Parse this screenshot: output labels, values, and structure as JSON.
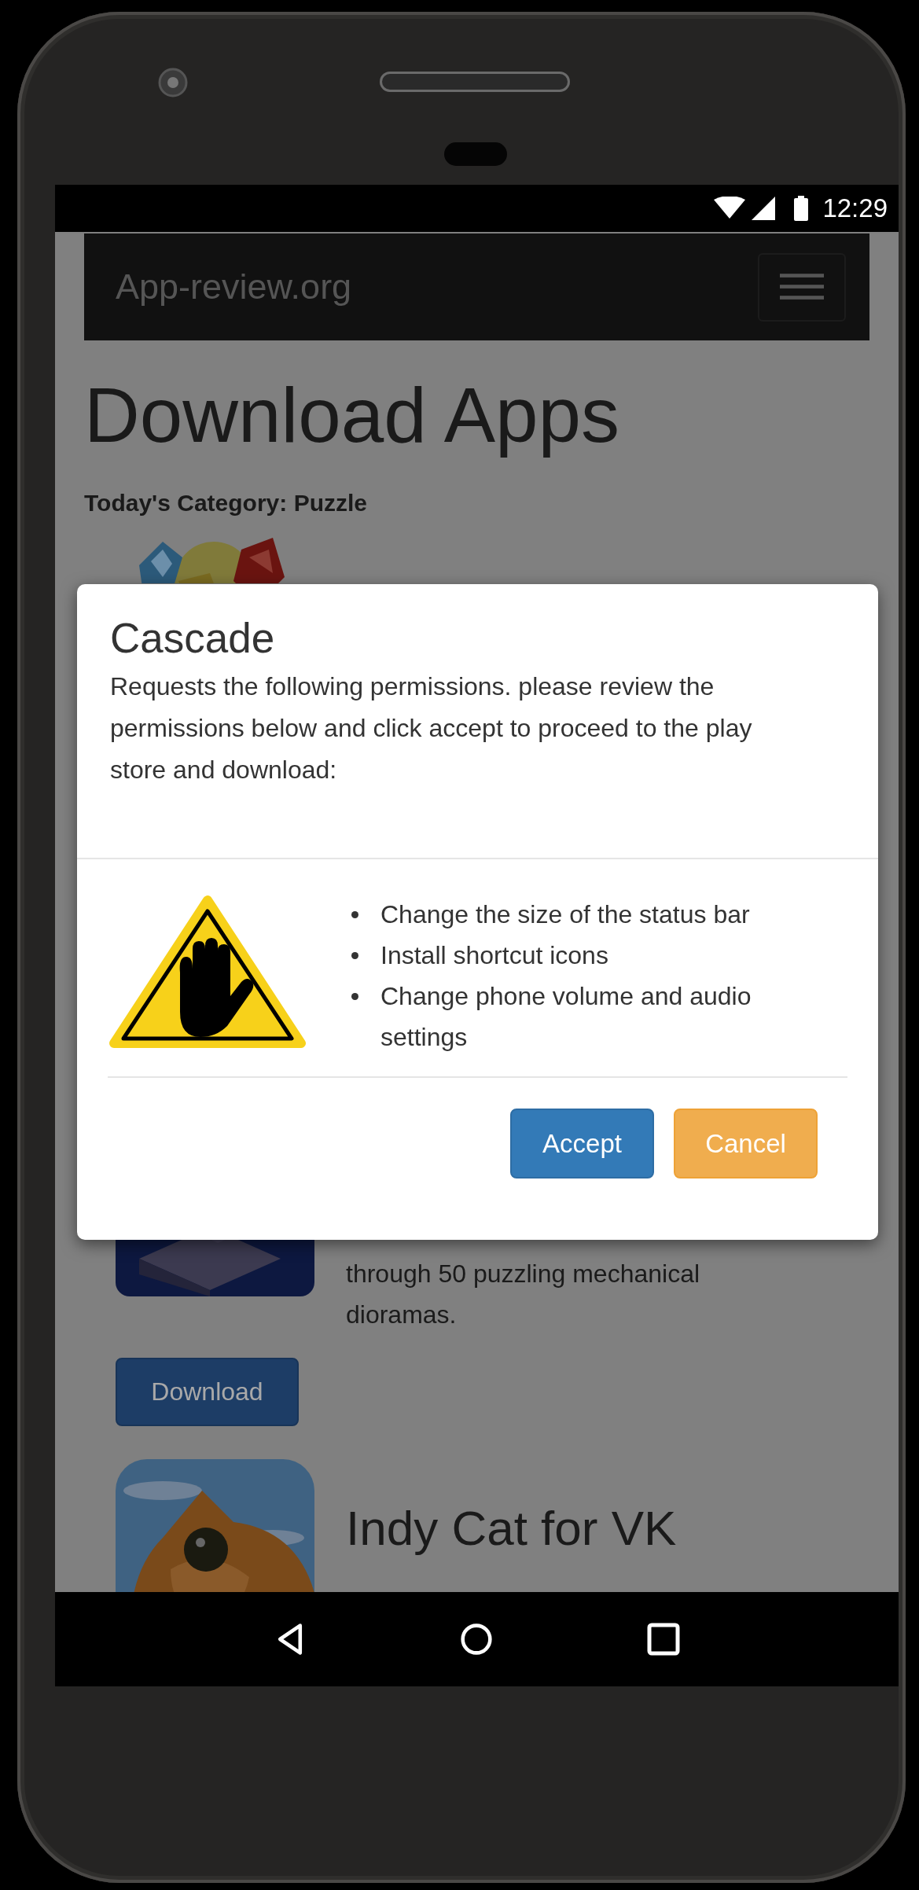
{
  "status_bar": {
    "time": "12:29"
  },
  "navbar": {
    "brand": "App-review.org"
  },
  "page": {
    "title": "Download Apps",
    "category": "Today's Category: Puzzle"
  },
  "apps": [
    {
      "kind": "picture"
    },
    {
      "kind": "picture",
      "description": "through 50 puzzling mechanical dioramas.",
      "button": "Download"
    },
    {
      "kind": "picture",
      "title": "Indy Cat for VK"
    }
  ],
  "dialog": {
    "title": "Cascade",
    "message": "Requests the following permissions. please review the permissions below and click accept to proceed to the play store and download:",
    "permissions": [
      "Change the size of the status bar",
      "Install shortcut icons",
      "Change phone volume and audio settings"
    ],
    "buttons": [
      {
        "label": "Accept",
        "kind": "primary"
      },
      {
        "label": "Cancel",
        "kind": "warning"
      }
    ]
  }
}
